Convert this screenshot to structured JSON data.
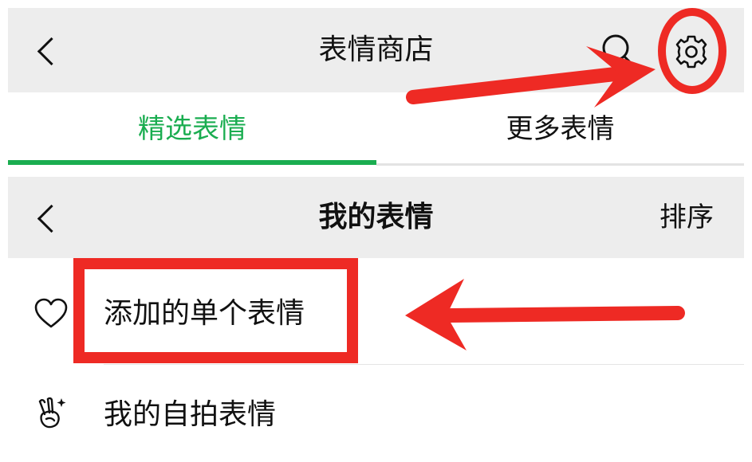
{
  "store": {
    "title": "表情商店"
  },
  "tabs": [
    {
      "label": "精选表情",
      "selected": true
    },
    {
      "label": "更多表情",
      "selected": false
    }
  ],
  "my_stickers": {
    "title": "我的表情",
    "sort_label": "排序",
    "items": [
      {
        "label": "添加的单个表情",
        "icon": "heart-icon"
      },
      {
        "label": "我的自拍表情",
        "icon": "peace-hand-icon"
      }
    ]
  },
  "colors": {
    "accent_green": "#1aad50",
    "annotation_red": "#ee2a24",
    "bar_gray": "#ededed"
  }
}
